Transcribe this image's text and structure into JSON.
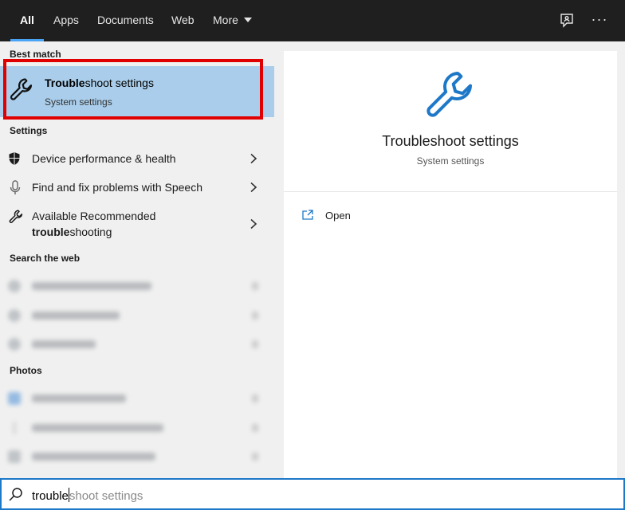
{
  "tabs": [
    {
      "label": "All",
      "active": true
    },
    {
      "label": "Apps"
    },
    {
      "label": "Documents"
    },
    {
      "label": "Web"
    },
    {
      "label": "More"
    }
  ],
  "header_icons": [
    "feedback-icon",
    "more-options-icon"
  ],
  "header_more_glyph": "···",
  "sections": {
    "best_match": "Best match",
    "settings": "Settings",
    "search_web": "Search the web",
    "photos": "Photos"
  },
  "best_match": {
    "title_bold": "Trouble",
    "title_rest": "shoot settings",
    "subtitle": "System settings",
    "icon": "wrench-icon"
  },
  "settings_items": [
    {
      "label": "Device performance & health",
      "icon": "shield-icon"
    },
    {
      "label": "Find and fix problems with Speech",
      "icon": "microphone-icon"
    },
    {
      "label_line1": "Available Recommended",
      "label_line2_bold": "trouble",
      "label_line2_rest": "shooting",
      "icon": "wrench-icon"
    }
  ],
  "preview": {
    "title": "Troubleshoot settings",
    "subtitle": "System settings",
    "actions": [
      {
        "label": "Open",
        "icon": "open-icon"
      }
    ]
  },
  "search": {
    "typed": "trouble",
    "suggestion": "shoot settings"
  },
  "colors": {
    "accent": "#1e78c8",
    "selected_bg": "#a9cdea",
    "highlight": "#e10000",
    "topbar": "#1f1f1f"
  }
}
